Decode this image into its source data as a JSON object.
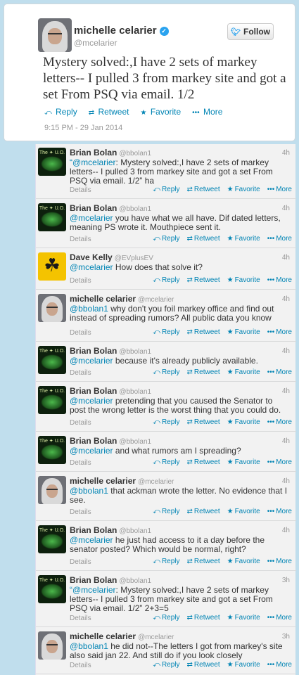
{
  "tweet": {
    "name": "michelle celarier",
    "handle": "@mcelarier",
    "follow_label": "Follow",
    "text": "Mystery solved:,I have 2 sets of markey letters-- I pulled 3 from markey site and got a set From PSQ via email. 1/2",
    "actions": {
      "reply": "Reply",
      "retweet": "Retweet",
      "favorite": "Favorite",
      "more": "More"
    },
    "date": "9:15 PM - 29 Jan 2014"
  },
  "reply_actions": {
    "details": "Details",
    "reply": "Reply",
    "retweet": "Retweet",
    "favorite": "Favorite",
    "more": "More"
  },
  "replies": [
    {
      "name": "Brian Bolan",
      "handle": "@bbolan1",
      "time": "4h",
      "avatar": "bb",
      "mention": "“@mcelarier",
      "text": ": Mystery solved:,I have 2 sets of markey letters-- I pulled 3 from markey site and  got a set From PSQ via email. 1/2” ha"
    },
    {
      "name": "Brian Bolan",
      "handle": "@bbolan1",
      "time": "4h",
      "avatar": "bb",
      "mention": "@mcelarier",
      "text": " you have what we all have.  Dif dated letters, meaning PS wrote it. Mouthpiece sent it."
    },
    {
      "name": "Dave Kelly",
      "handle": "@EVplusEV",
      "time": "4h",
      "avatar": "dk",
      "mention": "@mcelarier",
      "text": " How does that solve it?"
    },
    {
      "name": "michelle celarier",
      "handle": "@mcelarier",
      "time": "4h",
      "avatar": "mc",
      "mention": "@bbolan1",
      "text": " why don't you foil markey office and find out instead of spreading rumors? All public data you know"
    },
    {
      "name": "Brian Bolan",
      "handle": "@bbolan1",
      "time": "4h",
      "avatar": "bb",
      "mention": "@mcelarier",
      "text": " because it's already publicly available."
    },
    {
      "name": "Brian Bolan",
      "handle": "@bbolan1",
      "time": "4h",
      "avatar": "bb",
      "mention": "@mcelarier",
      "text": " pretending that you caused the Senator to post the wrong letter is the worst thing that you could do."
    },
    {
      "name": "Brian Bolan",
      "handle": "@bbolan1",
      "time": "4h",
      "avatar": "bb",
      "mention": "@mcelarier",
      "text": " and what rumors am I spreading?"
    },
    {
      "name": "michelle celarier",
      "handle": "@mcelarier",
      "time": "4h",
      "avatar": "mc",
      "mention": "@bbolan1",
      "text": " that ackman wrote the letter. No evidence that I see."
    },
    {
      "name": "Brian Bolan",
      "handle": "@bbolan1",
      "time": "4h",
      "avatar": "bb",
      "mention": "@mcelarier",
      "text": " he just had access to it a day before the senator posted? Which would be normal, right?"
    },
    {
      "name": "Brian Bolan",
      "handle": "@bbolan1",
      "time": "3h",
      "avatar": "bb",
      "mention": "“@mcelarier",
      "text": ": Mystery solved:,I have 2 sets of markey letters-- I pulled 3 from markey site and  got a set From PSQ via email. 1/2” 2+3=5"
    },
    {
      "name": "michelle celarier",
      "handle": "@mcelarier",
      "time": "3h",
      "avatar": "mc",
      "mention": "@bbolan1",
      "text": " he did not--The letters I got from markey's site also said jan 22. And still do if you look closely"
    }
  ]
}
